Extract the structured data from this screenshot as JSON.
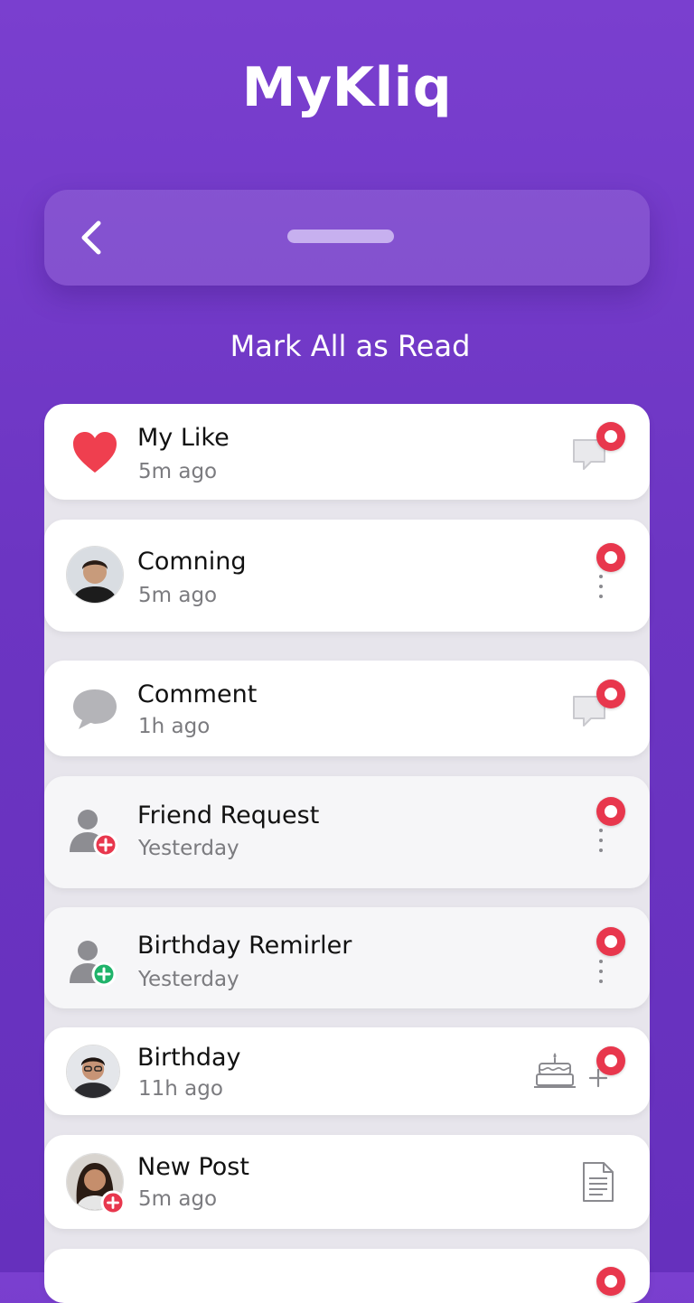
{
  "app": {
    "title": "MyKliq"
  },
  "nav": {
    "back_icon": "chevron-left-icon"
  },
  "actions": {
    "mark_all_read": "Mark All as Read"
  },
  "colors": {
    "accent": "#7a3fcf",
    "unread_dot": "#e8374d",
    "badge_add": "#e8374d",
    "badge_success": "#1fb36a"
  },
  "notifications": [
    {
      "title": "My Like",
      "time": "5m ago",
      "icon": "heart-icon",
      "action_icon": "chat-bubble-icon",
      "unread": true
    },
    {
      "title": "Comning",
      "time": "5m ago",
      "icon": "avatar",
      "action_icon": "more-vertical-icon",
      "unread": true
    },
    {
      "title": "Comment",
      "time": "1h ago",
      "icon": "comment-icon",
      "action_icon": "chat-bubble-icon",
      "unread": true
    },
    {
      "title": "Friend Request",
      "time": "Yesterday",
      "icon": "user-add-icon",
      "action_icon": "more-vertical-icon",
      "unread": true
    },
    {
      "title": "Birthday Remirler",
      "time": "Yesterday",
      "icon": "user-check-icon",
      "action_icon": "more-vertical-icon",
      "unread": true
    },
    {
      "title": "Birthday",
      "time": "11h ago",
      "icon": "avatar",
      "action_icon": "cake-icon",
      "unread": true
    },
    {
      "title": "New Post",
      "time": "5m ago",
      "icon": "avatar",
      "action_icon": "document-icon",
      "unread": false
    }
  ]
}
